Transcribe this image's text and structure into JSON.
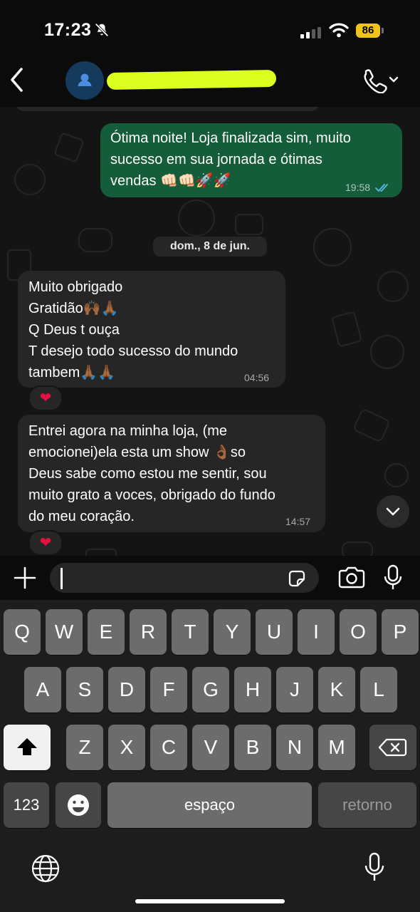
{
  "status_bar": {
    "time": "17:23",
    "battery": "86"
  },
  "header": {
    "contact_name": ""
  },
  "messages": [
    {
      "direction": "outgoing",
      "text": "Ótima noite! Loja finalizada sim, muito\nsucesso em sua jornada e ótimas\nvendas 👊🏻👊🏻🚀🚀",
      "time": "19:58",
      "status": "read"
    },
    {
      "direction": "incoming",
      "text": "Muito obrigado\nGratidão🙌🏾🙏🏾\nQ Deus t ouça\nT desejo todo sucesso do mundo\ntambem🙏🏾🙏🏾",
      "time": "04:56",
      "reaction": "❤"
    },
    {
      "direction": "incoming",
      "text": "Entrei agora na minha loja, (me\nemocionei)ela esta um show 👌🏾so\nDeus sabe como estou me sentir, sou\nmuito grato a voces, obrigado do fundo\ndo meu coração.",
      "time": "14:57",
      "reaction": "❤"
    }
  ],
  "date_separator": "dom., 8 de jun.",
  "input": {
    "placeholder": ""
  },
  "keyboard": {
    "row1": [
      "Q",
      "W",
      "E",
      "R",
      "T",
      "Y",
      "U",
      "I",
      "O",
      "P"
    ],
    "row2": [
      "A",
      "S",
      "D",
      "F",
      "G",
      "H",
      "J",
      "K",
      "L"
    ],
    "row3": [
      "Z",
      "X",
      "C",
      "V",
      "B",
      "N",
      "M"
    ],
    "numbers_key": "123",
    "space_key": "espaço",
    "return_key": "retorno"
  },
  "colors": {
    "outgoing_bubble": "#145c3a",
    "incoming_bubble": "#262626",
    "read_ticks": "#53bdeb",
    "battery": "#f0c419",
    "reaction_heart": "#e3133f"
  }
}
